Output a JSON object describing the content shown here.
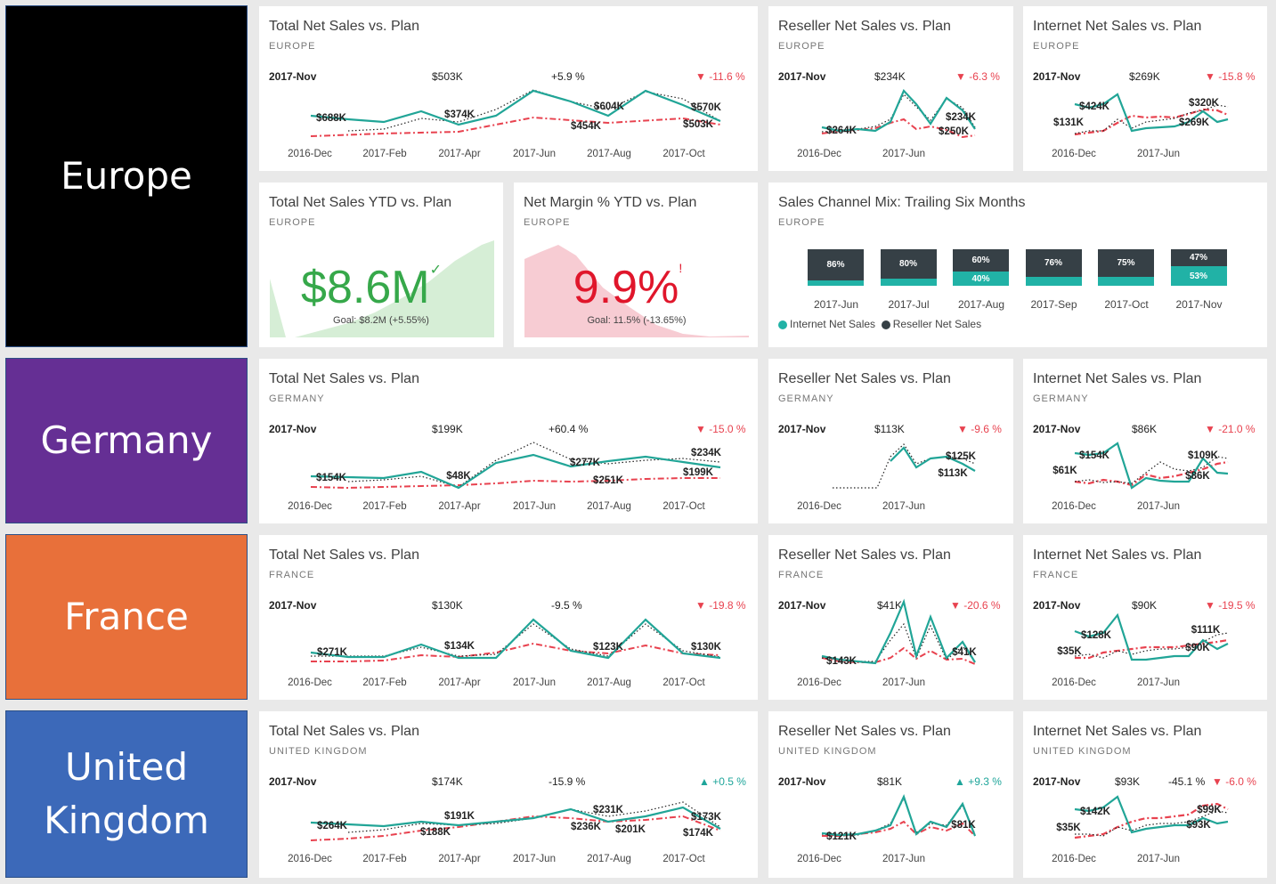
{
  "colors": {
    "actual": "#21a597",
    "plan": "#e8424f",
    "prior": "#222222",
    "region_europe": "#000000",
    "region_germany": "#652f94",
    "region_france": "#e8703a",
    "region_uk": "#3c69b9"
  },
  "europe": {
    "region_label": "Europe",
    "total": {
      "title": "Total Net Sales vs. Plan",
      "sub": "EUROPE",
      "period": "2017-Nov",
      "value": "$503K",
      "yoy": "+5.9 %",
      "kpi": "-11.6 %",
      "kpi_dir": "down",
      "axis": [
        "2016-Dec",
        "2017-Feb",
        "2017-Apr",
        "2017-Jun",
        "2017-Aug",
        "2017-Oct"
      ],
      "points": [
        "$688K",
        "$374K",
        "$604K",
        "$454K",
        "$570K",
        "$503K"
      ]
    },
    "reseller": {
      "title": "Reseller Net Sales vs. Plan",
      "sub": "EUROPE",
      "period": "2017-Nov",
      "value": "$234K",
      "kpi": "-6.3 %",
      "kpi_dir": "down",
      "axis": [
        "2016-Dec",
        "2017-Jun"
      ],
      "points": [
        "$264K",
        "$234K",
        "$250K"
      ]
    },
    "internet": {
      "title": "Internet Net Sales vs. Plan",
      "sub": "EUROPE",
      "period": "2017-Nov",
      "value": "$269K",
      "kpi": "-15.8 %",
      "kpi_dir": "down",
      "axis": [
        "2016-Dec",
        "2017-Jun"
      ],
      "points": [
        "$424K",
        "$131K",
        "$320K",
        "$269K"
      ]
    },
    "ytd": {
      "title": "Total Net Sales YTD vs. Plan",
      "sub": "EUROPE",
      "value": "$8.6M",
      "check": "✓",
      "goal": "Goal: $8.2M (+5.55%)"
    },
    "margin": {
      "title": "Net Margin % YTD vs. Plan",
      "sub": "EUROPE",
      "value": "9.9%",
      "mark": "!",
      "goal": "Goal: 11.5% (-13.65%)"
    },
    "mix": {
      "title": "Sales Channel Mix: Trailing Six Months",
      "sub": "EUROPE",
      "months": [
        {
          "label": "2017-Jun",
          "reseller": "86%",
          "internet": "",
          "reseller_share": 0.86
        },
        {
          "label": "2017-Jul",
          "reseller": "80%",
          "internet": "",
          "reseller_share": 0.8
        },
        {
          "label": "2017-Aug",
          "reseller": "60%",
          "internet": "40%",
          "reseller_share": 0.6
        },
        {
          "label": "2017-Sep",
          "reseller": "76%",
          "internet": "",
          "reseller_share": 0.76
        },
        {
          "label": "2017-Oct",
          "reseller": "75%",
          "internet": "",
          "reseller_share": 0.75
        },
        {
          "label": "2017-Nov",
          "reseller": "47%",
          "internet": "53%",
          "reseller_share": 0.47
        }
      ],
      "legend_internet": "Internet Net Sales",
      "legend_reseller": "Reseller Net Sales"
    }
  },
  "germany": {
    "region_label": "Germany",
    "total": {
      "title": "Total Net Sales vs. Plan",
      "sub": "GERMANY",
      "period": "2017-Nov",
      "value": "$199K",
      "yoy": "+60.4 %",
      "kpi": "-15.0 %",
      "kpi_dir": "down",
      "axis": [
        "2016-Dec",
        "2017-Feb",
        "2017-Apr",
        "2017-Jun",
        "2017-Aug",
        "2017-Oct"
      ],
      "points": [
        "$154K",
        "$48K",
        "$277K",
        "$251K",
        "$234K",
        "$199K"
      ]
    },
    "reseller": {
      "title": "Reseller Net Sales vs. Plan",
      "sub": "GERMANY",
      "period": "2017-Nov",
      "value": "$113K",
      "kpi": "-9.6 %",
      "kpi_dir": "down",
      "axis": [
        "2016-Dec",
        "2017-Jun"
      ],
      "points": [
        "$125K",
        "$113K"
      ]
    },
    "internet": {
      "title": "Internet Net Sales vs. Plan",
      "sub": "GERMANY",
      "period": "2017-Nov",
      "value": "$86K",
      "kpi": "-21.0 %",
      "kpi_dir": "down",
      "axis": [
        "2016-Dec",
        "2017-Jun"
      ],
      "points": [
        "$154K",
        "$61K",
        "$109K",
        "$86K"
      ]
    }
  },
  "france": {
    "region_label": "France",
    "total": {
      "title": "Total Net Sales vs. Plan",
      "sub": "FRANCE",
      "period": "2017-Nov",
      "value": "$130K",
      "yoy": "-9.5 %",
      "kpi": "-19.8 %",
      "kpi_dir": "down",
      "axis": [
        "2016-Dec",
        "2017-Feb",
        "2017-Apr",
        "2017-Jun",
        "2017-Aug",
        "2017-Oct"
      ],
      "points": [
        "$271K",
        "$134K",
        "$123K",
        "$130K"
      ]
    },
    "reseller": {
      "title": "Reseller Net Sales vs. Plan",
      "sub": "FRANCE",
      "period": "2017-Nov",
      "value": "$41K",
      "kpi": "-20.6 %",
      "kpi_dir": "down",
      "axis": [
        "2016-Dec",
        "2017-Jun"
      ],
      "points": [
        "$143K",
        "$41K"
      ]
    },
    "internet": {
      "title": "Internet Net Sales vs. Plan",
      "sub": "FRANCE",
      "period": "2017-Nov",
      "value": "$90K",
      "kpi": "-19.5 %",
      "kpi_dir": "down",
      "axis": [
        "2016-Dec",
        "2017-Jun"
      ],
      "points": [
        "$128K",
        "$35K",
        "$111K",
        "$90K"
      ]
    }
  },
  "uk": {
    "region_label_line1": "United",
    "region_label_line2": "Kingdom",
    "total": {
      "title": "Total Net Sales vs. Plan",
      "sub": "UNITED KINGDOM",
      "period": "2017-Nov",
      "value": "$174K",
      "yoy": "-15.9 %",
      "kpi": "+0.5 %",
      "kpi_dir": "up",
      "axis": [
        "2016-Dec",
        "2017-Feb",
        "2017-Apr",
        "2017-Jun",
        "2017-Aug",
        "2017-Oct"
      ],
      "points": [
        "$264K",
        "$191K",
        "$188K",
        "$231K",
        "$236K",
        "$201K",
        "$173K",
        "$174K"
      ]
    },
    "reseller": {
      "title": "Reseller Net Sales vs. Plan",
      "sub": "UNITED KINGDOM",
      "period": "2017-Nov",
      "value": "$81K",
      "kpi": "+9.3 %",
      "kpi_dir": "up",
      "axis": [
        "2016-Dec",
        "2017-Jun"
      ],
      "points": [
        "$121K",
        "$81K"
      ]
    },
    "internet": {
      "title": "Internet Net Sales vs. Plan",
      "sub": "UNITED KINGDOM",
      "period": "2017-Nov",
      "value": "$93K",
      "yoy": "-45.1 %",
      "kpi": "-6.0 %",
      "kpi_dir": "down",
      "axis": [
        "2016-Dec",
        "2017-Jun"
      ],
      "points": [
        "$142K",
        "$35K",
        "$99K",
        "$93K"
      ]
    }
  }
}
